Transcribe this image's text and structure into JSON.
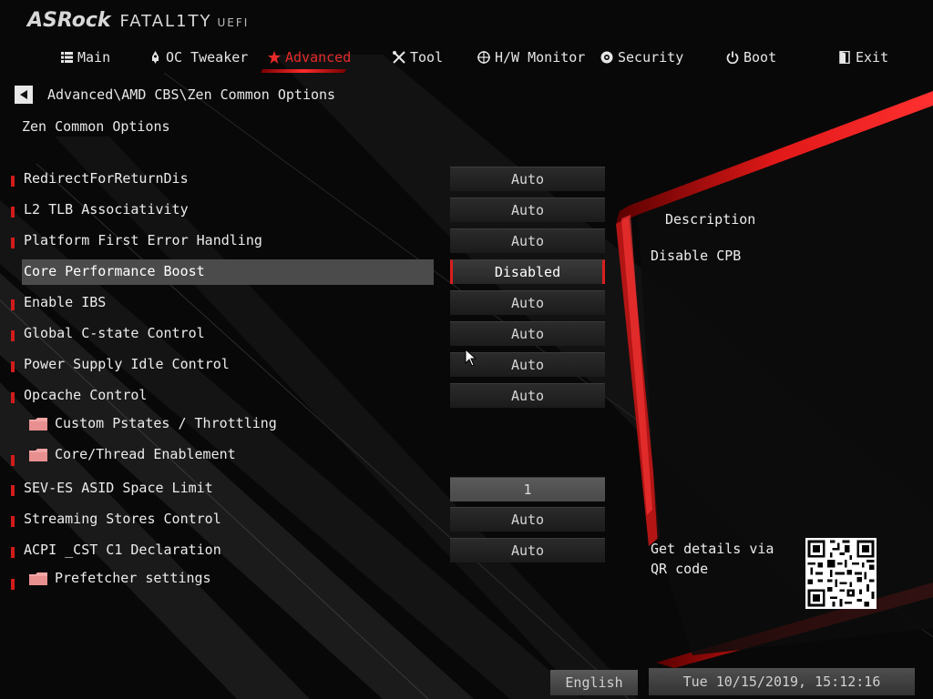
{
  "header": {
    "brand": "ASRock",
    "product": "FATAL1TY",
    "suffix": "UEFI"
  },
  "nav": {
    "items": [
      {
        "label": "Main",
        "icon": "list-icon"
      },
      {
        "label": "OC Tweaker",
        "icon": "rocket-icon"
      },
      {
        "label": "Advanced",
        "icon": "star-icon",
        "active": true
      },
      {
        "label": "Tool",
        "icon": "tools-icon"
      },
      {
        "label": "H/W Monitor",
        "icon": "crosshair-icon"
      },
      {
        "label": "Security",
        "icon": "shield-icon"
      },
      {
        "label": "Boot",
        "icon": "power-icon"
      },
      {
        "label": "Exit",
        "icon": "exit-door-icon"
      }
    ]
  },
  "breadcrumb": "Advanced\\AMD CBS\\Zen Common Options",
  "section_title": "Zen Common Options",
  "settings": [
    {
      "label": "RedirectForReturnDis",
      "value": "Auto"
    },
    {
      "label": "L2 TLB Associativity",
      "value": "Auto"
    },
    {
      "label": "Platform First Error Handling",
      "value": "Auto"
    },
    {
      "label": "Core Performance Boost",
      "value": "Disabled",
      "selected": true
    },
    {
      "label": "Enable IBS",
      "value": "Auto"
    },
    {
      "label": "Global C-state Control",
      "value": "Auto"
    },
    {
      "label": "Power Supply Idle Control",
      "value": "Auto"
    },
    {
      "label": "Opcache Control",
      "value": "Auto"
    },
    {
      "label": "Custom Pstates / Throttling",
      "type": "submenu"
    },
    {
      "label": "Core/Thread Enablement",
      "type": "submenu"
    },
    {
      "label": "SEV-ES ASID Space Limit",
      "value": "1"
    },
    {
      "label": "Streaming Stores Control",
      "value": "Auto"
    },
    {
      "label": "ACPI _CST C1 Declaration",
      "value": "Auto"
    },
    {
      "label": "Prefetcher settings",
      "type": "submenu"
    }
  ],
  "description": {
    "title": "Description",
    "text": "Disable CPB",
    "qr_text": "Get details via QR code"
  },
  "footer": {
    "language": "English",
    "datetime": "Tue 10/15/2019, 15:12:16"
  },
  "colors": {
    "accent": "#d81f1f",
    "background": "#070707",
    "highlight_row": "#4b4b4b"
  }
}
